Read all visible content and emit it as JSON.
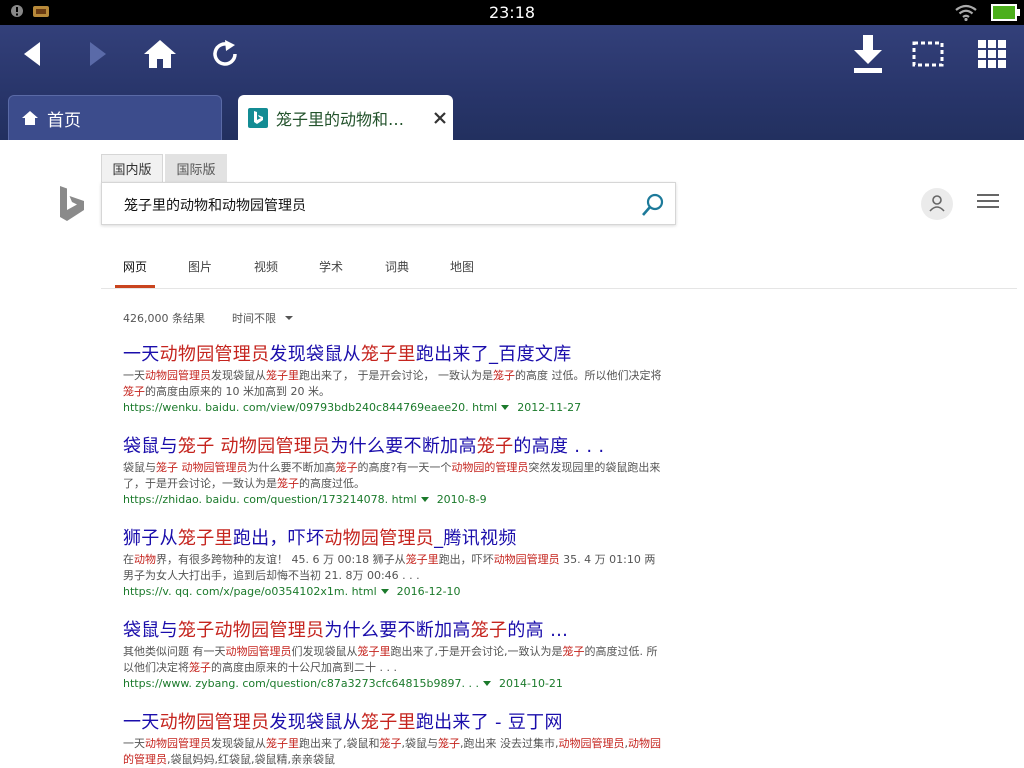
{
  "status_bar": {
    "time": "23:18"
  },
  "toolbar": {
    "back_icon": "back-arrow",
    "forward_icon": "forward-arrow",
    "home_icon": "home",
    "reload_icon": "reload",
    "download_icon": "download",
    "select_icon": "selection-rectangle",
    "apps_icon": "grid"
  },
  "tabs": [
    {
      "label": "首页",
      "active": false
    },
    {
      "label": "笼子里的动物和…",
      "active": true
    }
  ],
  "search": {
    "scopes": [
      "国内版",
      "国际版"
    ],
    "query": "笼子里的动物和动物园管理员"
  },
  "nav": [
    "网页",
    "图片",
    "视频",
    "学术",
    "词典",
    "地图"
  ],
  "results_meta": {
    "count": "426,000 条结果",
    "time_filter": "时间不限"
  },
  "results": [
    {
      "title": [
        {
          "t": "一天",
          "h": false
        },
        {
          "t": "动物园管理员",
          "h": true
        },
        {
          "t": "发现袋鼠从",
          "h": false
        },
        {
          "t": "笼子里",
          "h": true
        },
        {
          "t": "跑出来了_百度文库",
          "h": false
        }
      ],
      "snippet": [
        {
          "t": "一天",
          "h": false
        },
        {
          "t": "动物园管理员",
          "h": true
        },
        {
          "t": "发现袋鼠从",
          "h": false
        },
        {
          "t": "笼子里",
          "h": true
        },
        {
          "t": "跑出来了， 于是开会讨论， 一致认为是",
          "h": false
        },
        {
          "t": "笼子",
          "h": true
        },
        {
          "t": "的高度 过低。所以他们决定将",
          "h": false
        },
        {
          "t": "笼子",
          "h": true
        },
        {
          "t": "的高度由原来的 10 米加高到 20 米。",
          "h": false
        }
      ],
      "url": "https://wenku. baidu. com/view/09793bdb240c844769eaee20. html",
      "date": "2012-11-27"
    },
    {
      "title": [
        {
          "t": "袋鼠与",
          "h": false
        },
        {
          "t": "笼子",
          "h": true
        },
        {
          "t": " ",
          "h": false
        },
        {
          "t": "动物园管理员",
          "h": true
        },
        {
          "t": "为什么要不断加高",
          "h": false
        },
        {
          "t": "笼子",
          "h": true
        },
        {
          "t": "的高度 . . .",
          "h": false
        }
      ],
      "snippet": [
        {
          "t": "袋鼠与",
          "h": false
        },
        {
          "t": "笼子",
          "h": true
        },
        {
          "t": " ",
          "h": false
        },
        {
          "t": "动物园管理员",
          "h": true
        },
        {
          "t": "为什么要不断加高",
          "h": false
        },
        {
          "t": "笼子",
          "h": true
        },
        {
          "t": "的高度?有一天一个",
          "h": false
        },
        {
          "t": "动物园的管理员",
          "h": true
        },
        {
          "t": "突然发现园里的袋鼠跑出来了，于是开会讨论，一致认为是",
          "h": false
        },
        {
          "t": "笼子",
          "h": true
        },
        {
          "t": "的高度过低。",
          "h": false
        }
      ],
      "url": "https://zhidao. baidu. com/question/173214078. html",
      "date": "2010-8-9"
    },
    {
      "title": [
        {
          "t": "狮子从",
          "h": false
        },
        {
          "t": "笼子里",
          "h": true
        },
        {
          "t": "跑出，吓坏",
          "h": false
        },
        {
          "t": "动物园管理员",
          "h": true
        },
        {
          "t": "_腾讯视频",
          "h": false
        }
      ],
      "snippet": [
        {
          "t": "在",
          "h": false
        },
        {
          "t": "动物",
          "h": true
        },
        {
          "t": "界，有很多跨物种的友谊！ 45. 6 万 00:18 狮子从",
          "h": false
        },
        {
          "t": "笼子里",
          "h": true
        },
        {
          "t": "跑出，吓坏",
          "h": false
        },
        {
          "t": "动物园管理员",
          "h": true
        },
        {
          "t": " 35. 4 万 01:10 两男子为女人大打出手，追到后却悔不当初 21. 8万 00:46 . . .",
          "h": false
        }
      ],
      "url": "https://v. qq. com/x/page/o0354102x1m. html",
      "date": "2016-12-10"
    },
    {
      "title": [
        {
          "t": "袋鼠与",
          "h": false
        },
        {
          "t": "笼子动物园管理员",
          "h": true
        },
        {
          "t": "为什么要不断加高",
          "h": false
        },
        {
          "t": "笼子",
          "h": true
        },
        {
          "t": "的高 …",
          "h": false
        }
      ],
      "snippet": [
        {
          "t": "其他类似问题 有一天",
          "h": false
        },
        {
          "t": "动物园管理员",
          "h": true
        },
        {
          "t": "们发现袋鼠从",
          "h": false
        },
        {
          "t": "笼子里",
          "h": true
        },
        {
          "t": "跑出来了,于是开会讨论,一致认为是",
          "h": false
        },
        {
          "t": "笼子",
          "h": true
        },
        {
          "t": "的高度过低. 所以他们决定将",
          "h": false
        },
        {
          "t": "笼子",
          "h": true
        },
        {
          "t": "的高度由原来的十公尺加高到二十 . . .",
          "h": false
        }
      ],
      "url": "https://www. zybang. com/question/c87a3273cfc64815b9897. . .",
      "date": "2014-10-21"
    },
    {
      "title": [
        {
          "t": "一天",
          "h": false
        },
        {
          "t": "动物园管理员",
          "h": true
        },
        {
          "t": "发现袋鼠从",
          "h": false
        },
        {
          "t": "笼子里",
          "h": true
        },
        {
          "t": "跑出来了 - 豆丁网",
          "h": false
        }
      ],
      "snippet": [
        {
          "t": "一天",
          "h": false
        },
        {
          "t": "动物园管理员",
          "h": true
        },
        {
          "t": "发现袋鼠从",
          "h": false
        },
        {
          "t": "笼子里",
          "h": true
        },
        {
          "t": "跑出来了,袋鼠和",
          "h": false
        },
        {
          "t": "笼子",
          "h": true
        },
        {
          "t": ",袋鼠与",
          "h": false
        },
        {
          "t": "笼子",
          "h": true
        },
        {
          "t": ",跑出来 没去过集市,",
          "h": false
        },
        {
          "t": "动物园管理员",
          "h": true
        },
        {
          "t": ",",
          "h": false
        },
        {
          "t": "动物园的管理员",
          "h": true
        },
        {
          "t": ",袋鼠妈妈,红袋鼠,袋鼠精,亲亲袋鼠",
          "h": false
        }
      ],
      "url": "",
      "date": ""
    }
  ],
  "colors": {
    "toolbar": "#2a376c",
    "link": "#1a0dab",
    "highlight": "#c5241e",
    "url": "#1b7a2b",
    "nav_active": "#c9441e"
  }
}
